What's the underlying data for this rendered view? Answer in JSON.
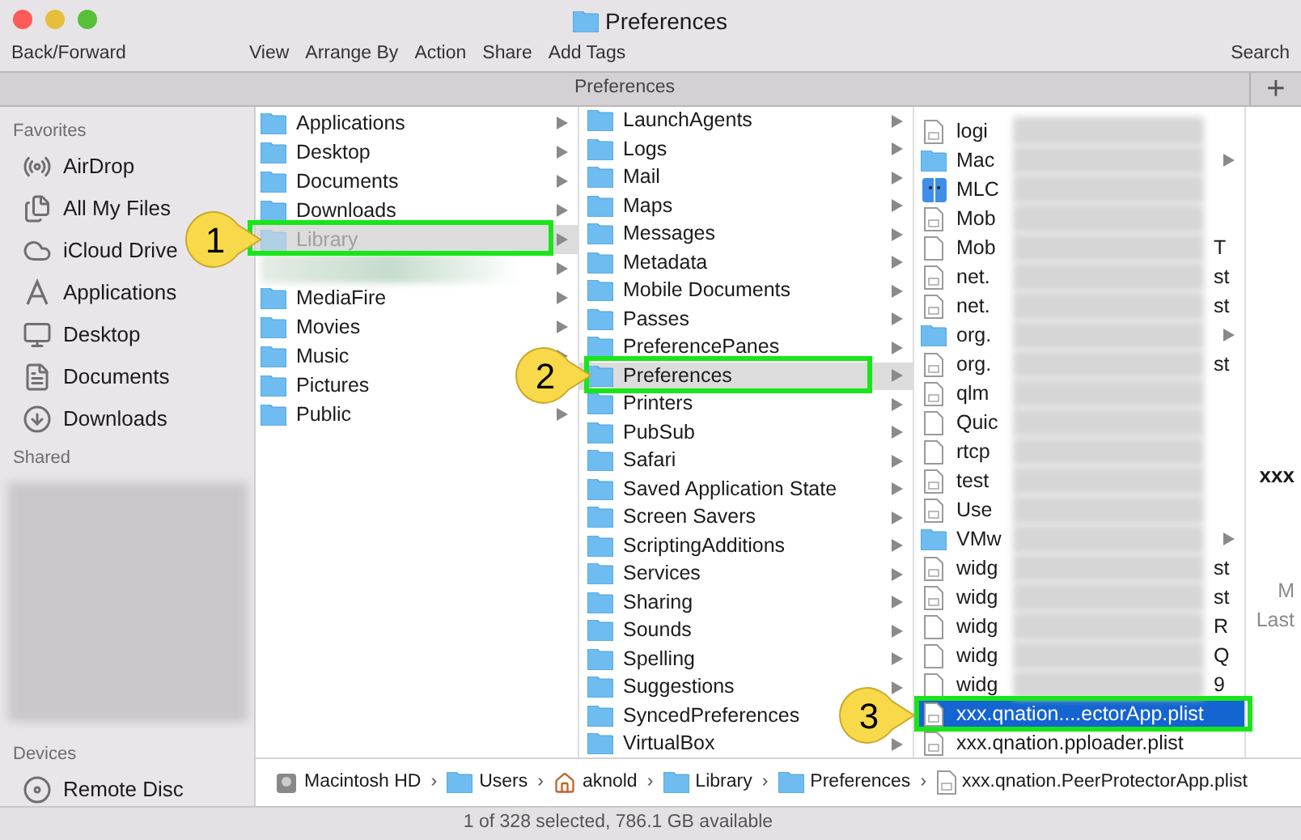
{
  "window": {
    "title": "Preferences"
  },
  "toolbar": {
    "left": "Back/Forward",
    "items": [
      "View",
      "Arrange By",
      "Action",
      "Share",
      "Add Tags"
    ],
    "right": "Search"
  },
  "tab_bar": {
    "title": "Preferences",
    "add": "+"
  },
  "sidebar": {
    "sections": [
      {
        "kind": "list",
        "title": "Favorites",
        "items": [
          {
            "kind": "airdrop",
            "label": "AirDrop"
          },
          {
            "kind": "files",
            "label": "All My Files"
          },
          {
            "kind": "cloud",
            "label": "iCloud Drive"
          },
          {
            "kind": "apps",
            "label": "Applications"
          },
          {
            "kind": "desktop",
            "label": "Desktop"
          },
          {
            "kind": "documents",
            "label": "Documents"
          },
          {
            "kind": "downloads",
            "label": "Downloads"
          }
        ]
      },
      {
        "kind": "blurred",
        "title": "Shared"
      },
      {
        "kind": "list",
        "title": "Devices",
        "items": [
          {
            "kind": "disc",
            "label": "Remote Disc"
          }
        ]
      }
    ]
  },
  "column_1": [
    {
      "kind": "folder",
      "label": "Applications",
      "selected": false,
      "dimmed": false
    },
    {
      "kind": "folder",
      "label": "Desktop",
      "selected": false,
      "dimmed": false
    },
    {
      "kind": "folder",
      "label": "Documents",
      "selected": false,
      "dimmed": false
    },
    {
      "kind": "folder",
      "label": "Downloads",
      "selected": false,
      "dimmed": false
    },
    {
      "kind": "folder",
      "label": "Library",
      "selected": true,
      "dimmed": true
    },
    {
      "kind": "blurred",
      "selected": false,
      "dimmed": false
    },
    {
      "kind": "folder",
      "label": "MediaFire",
      "selected": false,
      "dimmed": false
    },
    {
      "kind": "folder",
      "label": "Movies",
      "selected": false,
      "dimmed": false
    },
    {
      "kind": "folder",
      "label": "Music",
      "selected": false,
      "dimmed": false
    },
    {
      "kind": "folder",
      "label": "Pictures",
      "selected": false,
      "dimmed": false
    },
    {
      "kind": "folder",
      "label": "Public",
      "selected": false,
      "dimmed": false
    }
  ],
  "column_2": [
    {
      "label": "LaunchAgents",
      "selected": false
    },
    {
      "label": "Logs",
      "selected": false
    },
    {
      "label": "Mail",
      "selected": false
    },
    {
      "label": "Maps",
      "selected": false
    },
    {
      "label": "Messages",
      "selected": false
    },
    {
      "label": "Metadata",
      "selected": false
    },
    {
      "label": "Mobile Documents",
      "selected": false
    },
    {
      "label": "Passes",
      "selected": false
    },
    {
      "label": "PreferencePanes",
      "selected": false
    },
    {
      "label": "Preferences",
      "selected": true
    },
    {
      "label": "Printers",
      "selected": false
    },
    {
      "label": "PubSub",
      "selected": false
    },
    {
      "label": "Safari",
      "selected": false
    },
    {
      "label": "Saved Application State",
      "selected": false
    },
    {
      "label": "Screen Savers",
      "selected": false
    },
    {
      "label": "ScriptingAdditions",
      "selected": false
    },
    {
      "label": "Services",
      "selected": false
    },
    {
      "label": "Sharing",
      "selected": false
    },
    {
      "label": "Sounds",
      "selected": false
    },
    {
      "label": "Spelling",
      "selected": false
    },
    {
      "label": "Suggestions",
      "selected": false
    },
    {
      "label": "SyncedPreferences",
      "selected": false
    },
    {
      "label": "VirtualBox",
      "selected": false
    }
  ],
  "column_3": [
    {
      "kind": "plist",
      "label": "logi",
      "obscured": true,
      "selected": false
    },
    {
      "kind": "folder",
      "label": "Mac",
      "obscured": true,
      "selected": false
    },
    {
      "kind": "app",
      "label": "MLC",
      "obscured": true,
      "selected": false
    },
    {
      "kind": "plist",
      "label": "Mob",
      "obscured": true,
      "selected": false
    },
    {
      "kind": "doc",
      "label": "Mob",
      "end": "T",
      "obscured": true,
      "selected": false
    },
    {
      "kind": "plist",
      "label": "net.",
      "end": "st",
      "obscured": true,
      "selected": false
    },
    {
      "kind": "plist",
      "label": "net.",
      "end": "st",
      "obscured": true,
      "selected": false
    },
    {
      "kind": "folder",
      "label": "org.",
      "obscured": true,
      "selected": false
    },
    {
      "kind": "plist",
      "label": "org.",
      "end": "st",
      "obscured": true,
      "selected": false
    },
    {
      "kind": "plist",
      "label": "qlm",
      "obscured": true,
      "selected": false
    },
    {
      "kind": "doc",
      "label": "Quic",
      "obscured": true,
      "selected": false
    },
    {
      "kind": "doc",
      "label": "rtcp",
      "obscured": true,
      "selected": false
    },
    {
      "kind": "plist",
      "label": "test",
      "obscured": true,
      "selected": false
    },
    {
      "kind": "plist",
      "label": "Use",
      "obscured": true,
      "selected": false
    },
    {
      "kind": "folder",
      "label": "VMw",
      "obscured": true,
      "selected": false
    },
    {
      "kind": "plist",
      "label": "widg",
      "end": "st",
      "obscured": true,
      "selected": false
    },
    {
      "kind": "plist",
      "label": "widg",
      "end": "st",
      "obscured": true,
      "selected": false
    },
    {
      "kind": "doc",
      "label": "widg",
      "end": "R",
      "obscured": true,
      "selected": false
    },
    {
      "kind": "doc",
      "label": "widg",
      "end": "Q",
      "obscured": true,
      "selected": false
    },
    {
      "kind": "doc",
      "label": "widg",
      "end": "9",
      "obscured": true,
      "selected": false
    },
    {
      "kind": "plist",
      "label": "xxx.qnation....ectorApp.plist",
      "obscured": false,
      "selected": true
    },
    {
      "kind": "plist",
      "label": "xxx.qnation.pploader.plist",
      "obscured": false,
      "selected": false
    }
  ],
  "preview": {
    "name": "xxx",
    "lines": [
      "M",
      "Last"
    ]
  },
  "path_bar": [
    {
      "kind": "disk",
      "label": "Macintosh HD"
    },
    {
      "kind": "users",
      "separator": "›",
      "label": "Users"
    },
    {
      "kind": "home",
      "separator": "›",
      "label": "aknold"
    },
    {
      "kind": "library",
      "separator": "›",
      "label": "Library"
    },
    {
      "kind": "folder",
      "separator": "›",
      "label": "Preferences"
    },
    {
      "kind": "plist",
      "separator": "›",
      "label": "xxx.qnation.PeerProtectorApp.plist"
    }
  ],
  "status_bar": "1 of 328 selected, 786.1 GB available",
  "annotations": [
    {
      "number": "1"
    },
    {
      "number": "2"
    },
    {
      "number": "3"
    }
  ]
}
